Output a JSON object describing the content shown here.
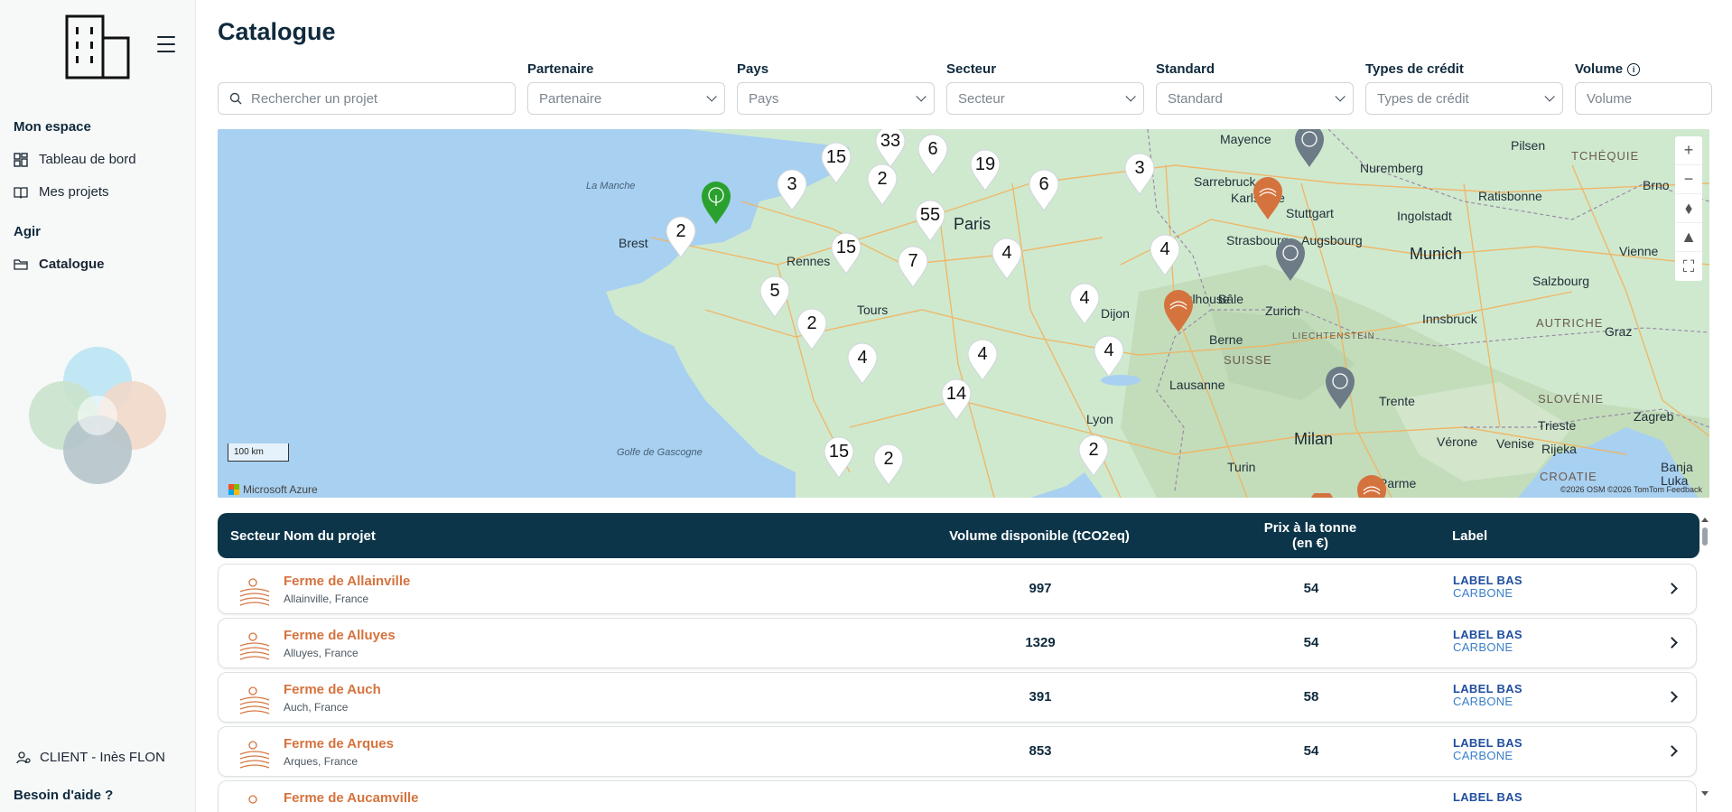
{
  "sidebar": {
    "section_mon_espace": "Mon espace",
    "section_agir": "Agir",
    "items": [
      {
        "label": "Tableau de bord",
        "icon": "dashboard-icon"
      },
      {
        "label": "Mes projets",
        "icon": "book-icon"
      },
      {
        "label": "Catalogue",
        "icon": "folder-icon",
        "active": true
      }
    ],
    "user": "CLIENT - Inès FLON",
    "help": "Besoin d'aide ?"
  },
  "header": {
    "title": "Catalogue"
  },
  "filters": {
    "search_placeholder": "Rechercher un projet",
    "partenaire": {
      "label": "Partenaire",
      "placeholder": "Partenaire"
    },
    "pays": {
      "label": "Pays",
      "placeholder": "Pays"
    },
    "secteur": {
      "label": "Secteur",
      "placeholder": "Secteur"
    },
    "standard": {
      "label": "Standard",
      "placeholder": "Standard"
    },
    "types_credit": {
      "label": "Types de crédit",
      "placeholder": "Types de crédit"
    },
    "volume": {
      "label": "Volume",
      "placeholder": "Volume"
    }
  },
  "map": {
    "places": [
      "La Manche",
      "Brest",
      "Rennes",
      "Paris",
      "Tours",
      "Dijon",
      "Lyon",
      "Golfe de Gascogne",
      "Mulhouse",
      "Bâle",
      "Berne",
      "Zurich",
      "SUISSE",
      "LIECHTENSTEIN",
      "Lausanne",
      "Milan",
      "Turin",
      "Trente",
      "Vérone",
      "Venise",
      "Parme",
      "Munich",
      "Strasbourg",
      "Stuttgart",
      "Karlsruhe",
      "Augsbourg",
      "Nuremberg",
      "Mayence",
      "Sarrebruck",
      "Ingolstadt",
      "Ratisbonne",
      "Pilsen",
      "TCHÉQUIE",
      "Brno",
      "Vienne",
      "Salzbourg",
      "Innsbruck",
      "AUTRICHE",
      "Graz",
      "SLOVÉNIE",
      "Trieste",
      "Zagreb",
      "Rijeka",
      "CROATIE",
      "Banja Luka"
    ],
    "cluster_counts": [
      "33",
      "6",
      "15",
      "3",
      "2",
      "19",
      "3",
      "6",
      "2",
      "55",
      "15",
      "7",
      "4",
      "4",
      "5",
      "2",
      "4",
      "4",
      "4",
      "4",
      "14",
      "15",
      "2"
    ],
    "scale": "100 km",
    "provider": "Microsoft Azure",
    "attribution": "©2026 OSM ©2026 TomTom Feedback"
  },
  "table": {
    "headers": {
      "sector_name": "Secteur Nom du projet",
      "volume": "Volume disponible (tCO2eq)",
      "price": "Prix à la tonne (en €)",
      "label": "Label"
    },
    "label_line1": "LABEL BAS",
    "label_line2": "CARBONE",
    "rows": [
      {
        "name": "Ferme de Allainville",
        "location": "Allainville, France",
        "volume": "997",
        "price": "54"
      },
      {
        "name": "Ferme de Alluyes",
        "location": "Alluyes, France",
        "volume": "1329",
        "price": "54"
      },
      {
        "name": "Ferme de Auch",
        "location": "Auch, France",
        "volume": "391",
        "price": "58"
      },
      {
        "name": "Ferme de Arques",
        "location": "Arques, France",
        "volume": "853",
        "price": "54"
      },
      {
        "name": "Ferme de Aucamville",
        "location": "",
        "volume": "",
        "price": ""
      }
    ]
  },
  "colors": {
    "navy": "#0c3549",
    "orange": "#d5733e",
    "green_pin": "#2aa12e",
    "gray_pin": "#6d7b86"
  }
}
